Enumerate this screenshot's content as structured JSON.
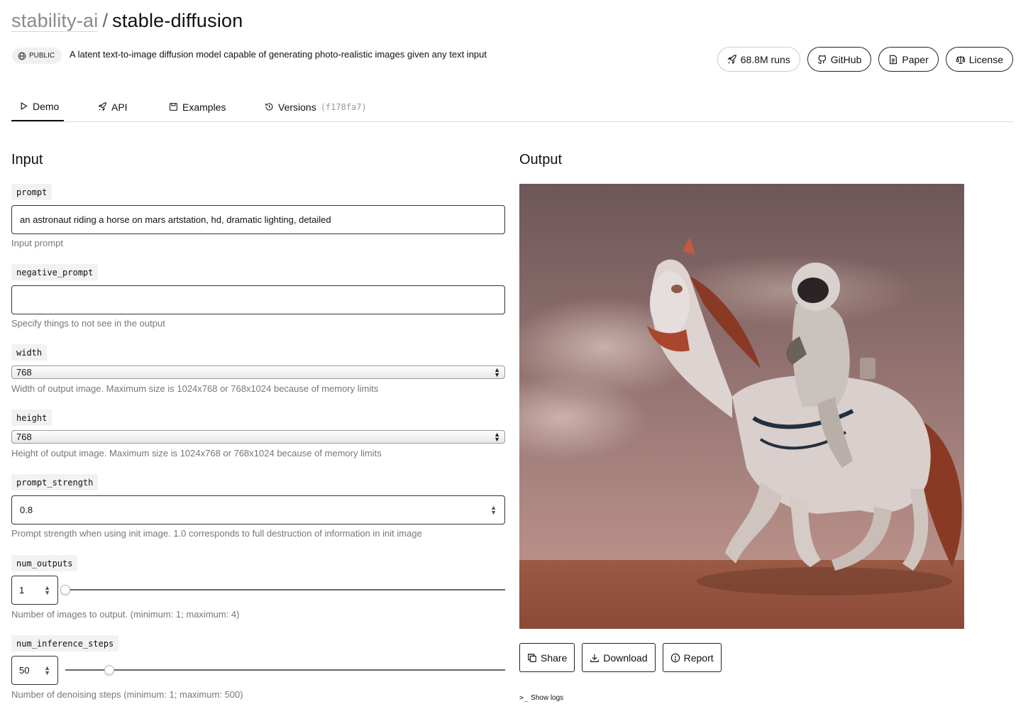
{
  "header": {
    "owner": "stability-ai",
    "separator": "/",
    "model": "stable-diffusion",
    "visibility": "PUBLIC",
    "description": "A latent text-to-image diffusion model capable of generating photo-realistic images given any text input",
    "runs": "68.8M runs",
    "github": "GitHub",
    "paper": "Paper",
    "license": "License"
  },
  "tabs": {
    "demo": "Demo",
    "api": "API",
    "examples": "Examples",
    "versions": "Versions",
    "version_hash": "(f178fa7)"
  },
  "input": {
    "title": "Input",
    "prompt": {
      "label": "prompt",
      "value": "an astronaut riding a horse on mars artstation, hd, dramatic lighting, detailed",
      "help": "Input prompt"
    },
    "negative_prompt": {
      "label": "negative_prompt",
      "value": "",
      "help": "Specify things to not see in the output"
    },
    "width": {
      "label": "width",
      "value": "768",
      "help": "Width of output image. Maximum size is 1024x768 or 768x1024 because of memory limits"
    },
    "height": {
      "label": "height",
      "value": "768",
      "help": "Height of output image. Maximum size is 1024x768 or 768x1024 because of memory limits"
    },
    "prompt_strength": {
      "label": "prompt_strength",
      "value": "0.8",
      "help": "Prompt strength when using init image. 1.0 corresponds to full destruction of information in init image"
    },
    "num_outputs": {
      "label": "num_outputs",
      "value": "1",
      "slider_fraction": 0.0,
      "help": "Number of images to output. (minimum: 1; maximum: 4)"
    },
    "num_inference_steps": {
      "label": "num_inference_steps",
      "value": "50",
      "slider_fraction": 0.1,
      "help": "Number of denoising steps (minimum: 1; maximum: 500)"
    }
  },
  "output": {
    "title": "Output",
    "share": "Share",
    "download": "Download",
    "report": "Report",
    "show_logs": "Show logs"
  },
  "colors": {
    "sky_top": "#6e5659",
    "sky_bottom": "#b89088",
    "ground": "#8a4a38",
    "horse_body": "#d9cfcc",
    "horse_mane": "#8a3a24"
  },
  "icons": [
    "globe-icon",
    "rocket-icon",
    "github-icon",
    "paper-icon",
    "scale-icon",
    "play-icon",
    "save-icon",
    "history-icon",
    "copy-icon",
    "download-icon",
    "alert-icon",
    "terminal-icon"
  ]
}
